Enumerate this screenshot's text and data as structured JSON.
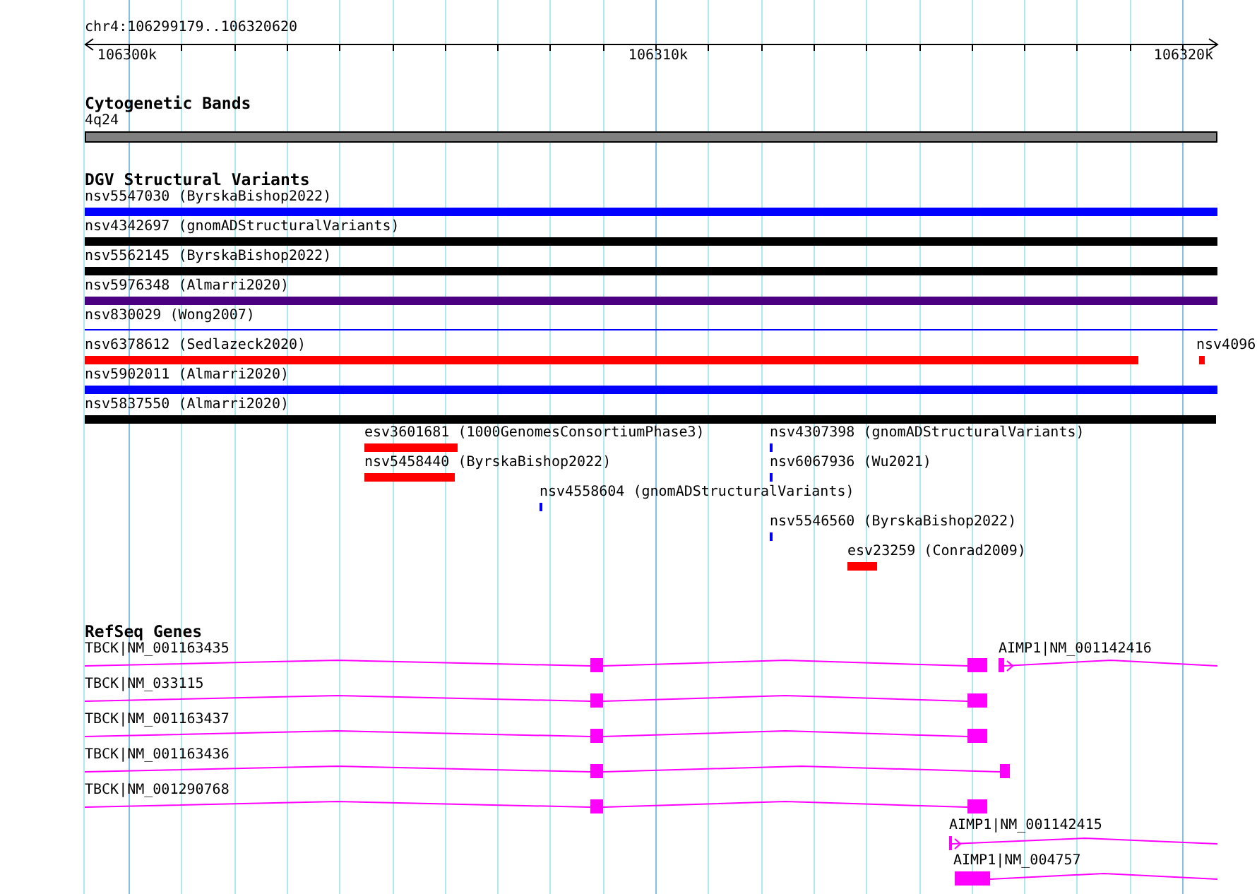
{
  "ruler": {
    "location": "chr4:106299179..106320620",
    "ticks": [
      {
        "label": "106300k"
      },
      {
        "label": "106310k"
      },
      {
        "label": "106320k"
      }
    ]
  },
  "cytogenetic_bands": {
    "title": "Cytogenetic Bands",
    "bands": [
      {
        "label": "4q24"
      }
    ]
  },
  "dgv_variants": {
    "title": "DGV Structural Variants",
    "features": [
      {
        "label": "nsv5547030 (ByrskaBishop2022)",
        "color": "#0000ff",
        "kind": "bar"
      },
      {
        "label": "nsv4342697 (gnomADStructuralVariants)",
        "color": "#000000",
        "kind": "bar"
      },
      {
        "label": "nsv5562145 (ByrskaBishop2022)",
        "color": "#000000",
        "kind": "bar"
      },
      {
        "label": "nsv5976348 (Almarri2020)",
        "color": "#4b0082",
        "kind": "bar"
      },
      {
        "label": "nsv830029 (Wong2007)",
        "color": "#0000ff",
        "kind": "line"
      },
      {
        "label": "nsv6378612 (Sedlazeck2020)",
        "color": "#ff0000",
        "kind": "bar"
      },
      {
        "label": "nsv4096",
        "color": "#ff0000",
        "kind": "bar"
      },
      {
        "label": "nsv5902011 (Almarri2020)",
        "color": "#0000ff",
        "kind": "bar"
      },
      {
        "label": "nsv5837550 (Almarri2020)",
        "color": "#000000",
        "kind": "bar"
      },
      {
        "label": "esv3601681 (1000GenomesConsortiumPhase3)",
        "color": "#ff0000",
        "kind": "bar"
      },
      {
        "label": "nsv4307398 (gnomADStructuralVariants)",
        "color": "#0000ff",
        "kind": "bar"
      },
      {
        "label": "nsv5458440 (ByrskaBishop2022)",
        "color": "#ff0000",
        "kind": "bar"
      },
      {
        "label": "nsv6067936 (Wu2021)",
        "color": "#0000ff",
        "kind": "bar"
      },
      {
        "label": "nsv4558604 (gnomADStructuralVariants)",
        "color": "#0000ff",
        "kind": "bar"
      },
      {
        "label": "nsv5546560 (ByrskaBishop2022)",
        "color": "#0000ff",
        "kind": "bar"
      },
      {
        "label": "esv23259 (Conrad2009)",
        "color": "#ff0000",
        "kind": "bar"
      }
    ]
  },
  "refseq_genes": {
    "title": "RefSeq Genes",
    "transcripts": [
      {
        "label": "TBCK|NM_001163435"
      },
      {
        "label": "AIMP1|NM_001142416"
      },
      {
        "label": "TBCK|NM_033115"
      },
      {
        "label": "TBCK|NM_001163437"
      },
      {
        "label": "TBCK|NM_001163436"
      },
      {
        "label": "TBCK|NM_001290768"
      },
      {
        "label": "AIMP1|NM_001142415"
      },
      {
        "label": "AIMP1|NM_004757"
      }
    ]
  }
}
